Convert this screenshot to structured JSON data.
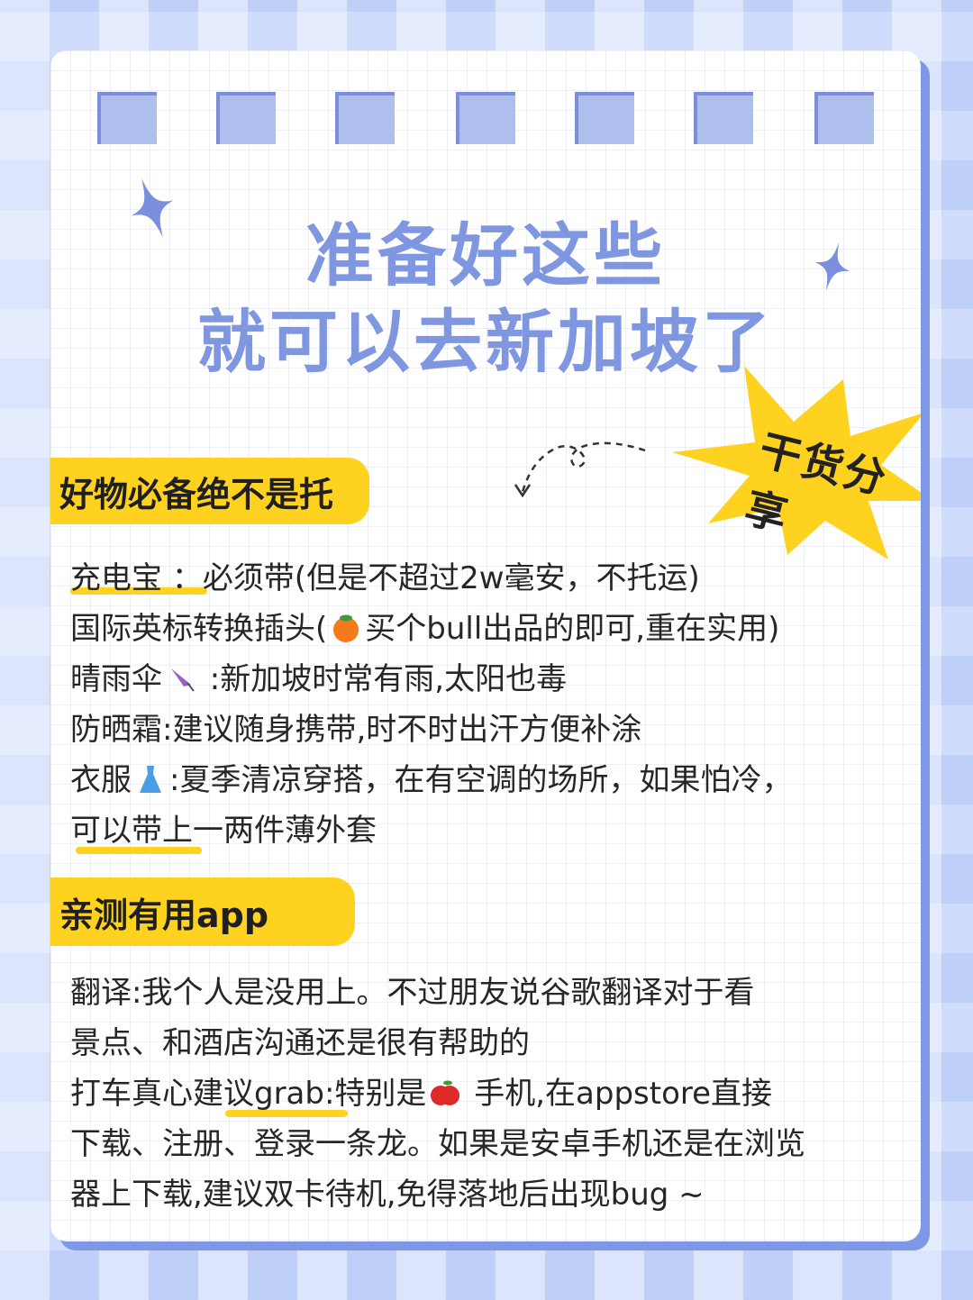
{
  "title": {
    "line1": "准备好这些",
    "line2": "就可以去新加坡了"
  },
  "badge": {
    "label": "干货分享"
  },
  "section1": {
    "tag": "好物必备绝不是托",
    "items": [
      {
        "a": "充电宝 ：",
        "b": "必须带(但是不超过2w毫安，不托运)"
      },
      {
        "a": "国际英标转换插头(",
        "icon": "peach-icon",
        "b": "买个bull出品的即可,重在实用)"
      },
      {
        "a": "晴雨伞",
        "icon": "umbrella-icon",
        "b": " :新加坡时常有雨,太阳也毒"
      },
      {
        "a": "防晒霜:建议随身携带,时不时出汗方便补涂"
      },
      {
        "a": "衣服",
        "icon": "dress-icon",
        "b": ":夏季清凉穿搭，在有空调的场所，如果怕冷，"
      },
      {
        "a": "可以带上一两件薄外套"
      }
    ]
  },
  "section2": {
    "tag": "亲测有用app",
    "items": [
      {
        "a": "翻译:我个人是没用上。不过朋友说谷歌翻译对于看"
      },
      {
        "a": "景点、和酒店沟通还是很有帮助的"
      },
      {
        "a": "打车真心建议grab:特别是",
        "icon": "apple-icon",
        "b": " 手机,在appstore直接"
      },
      {
        "a": "下载、注册、登录一条龙。如果是安卓手机还是在浏览"
      },
      {
        "a": "器上下载,建议双卡待机,免得落地后出现bug ~"
      }
    ]
  },
  "colors": {
    "accent_yellow": "#ffd21f",
    "title_blue": "#7f96e0",
    "background": "#cfdcfb"
  }
}
